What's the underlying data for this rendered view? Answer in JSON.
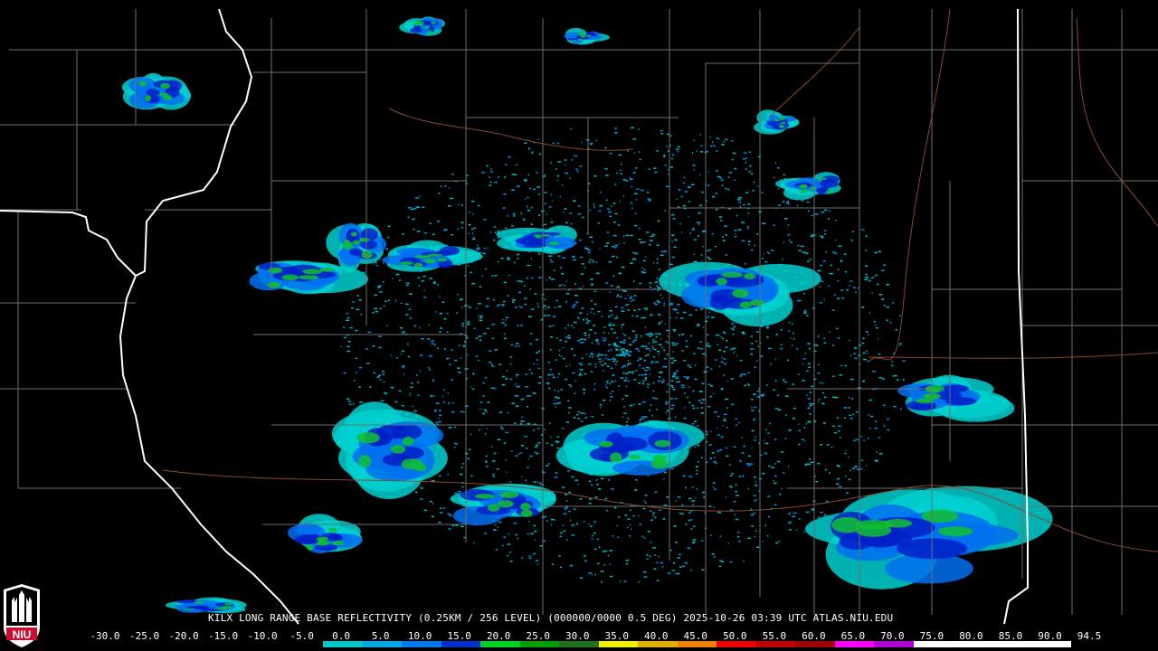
{
  "product_caption": "KILX LONG RANGE BASE REFLECTIVITY (0.25KM / 256 LEVEL) (000000/0000 0.5 DEG) 2025-10-26 03:39 UTC  ATLAS.NIU.EDU",
  "logo": {
    "text": "NIU",
    "accent": "#c8102e"
  },
  "colors": {
    "background": "#000000",
    "county_lines": "#6f6f6f",
    "state_lines": "#ffffff",
    "roads": "#8a4a2a"
  },
  "scale": {
    "labels": [
      "-30.0",
      "-25.0",
      "-20.0",
      "-15.0",
      "-10.0",
      "-5.0",
      "0.0",
      "5.0",
      "10.0",
      "15.0",
      "20.0",
      "25.0",
      "30.0",
      "35.0",
      "40.0",
      "45.0",
      "50.0",
      "55.0",
      "60.0",
      "65.0",
      "70.0",
      "75.0",
      "80.0",
      "85.0",
      "90.0",
      "94.5"
    ],
    "colors": [
      "#000000",
      "#000000",
      "#000000",
      "#000000",
      "#000000",
      "#000000",
      "#00c8c8",
      "#00a8e8",
      "#0078f0",
      "#0030d0",
      "#00d020",
      "#00a000",
      "#207020",
      "#f0f000",
      "#e0b000",
      "#f08000",
      "#f00000",
      "#c00000",
      "#a00000",
      "#ff00ff",
      "#b000d0",
      "#ffffff",
      "#ffffff",
      "#ffffff",
      "#ffffff"
    ]
  }
}
